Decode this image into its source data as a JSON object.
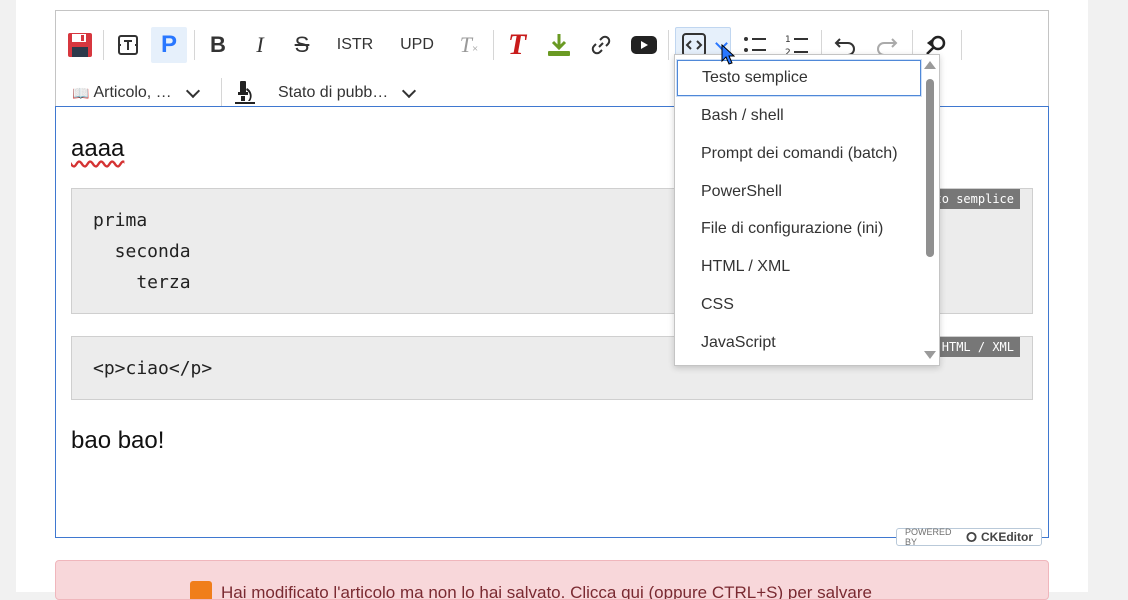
{
  "toolbar": {
    "save_label": "",
    "istr_label": "ISTR",
    "upd_label": "UPD",
    "article_label": "Articolo, …",
    "state_label": "Stato di pubb…",
    "book_icon": "📖"
  },
  "editor": {
    "heading": "aaaa",
    "code_blocks": [
      {
        "lines": "prima\n  seconda\n    terza",
        "language": "Testo semplice"
      },
      {
        "lines": "<p>ciao</p>",
        "language": "HTML / XML"
      }
    ],
    "closing": "bao bao!"
  },
  "dropdown": {
    "items": [
      "Testo semplice",
      "Bash / shell",
      "Prompt dei comandi (batch)",
      "PowerShell",
      "File di configurazione (ini)",
      "HTML / XML",
      "CSS",
      "JavaScript"
    ],
    "selected": "Testo semplice"
  },
  "powered": {
    "prefix": "POWERED BY",
    "brand": "CKEditor"
  },
  "alert": {
    "text": "Hai modificato l'articolo ma non lo hai salvato. Clicca qui (oppure CTRL+S) per salvare"
  },
  "colors": {
    "accent": "#2977ff",
    "save_red": "#d7373f",
    "title_red": "#c81b1b",
    "download_green": "#6a9a23",
    "alert_bg": "#f8d7da"
  }
}
